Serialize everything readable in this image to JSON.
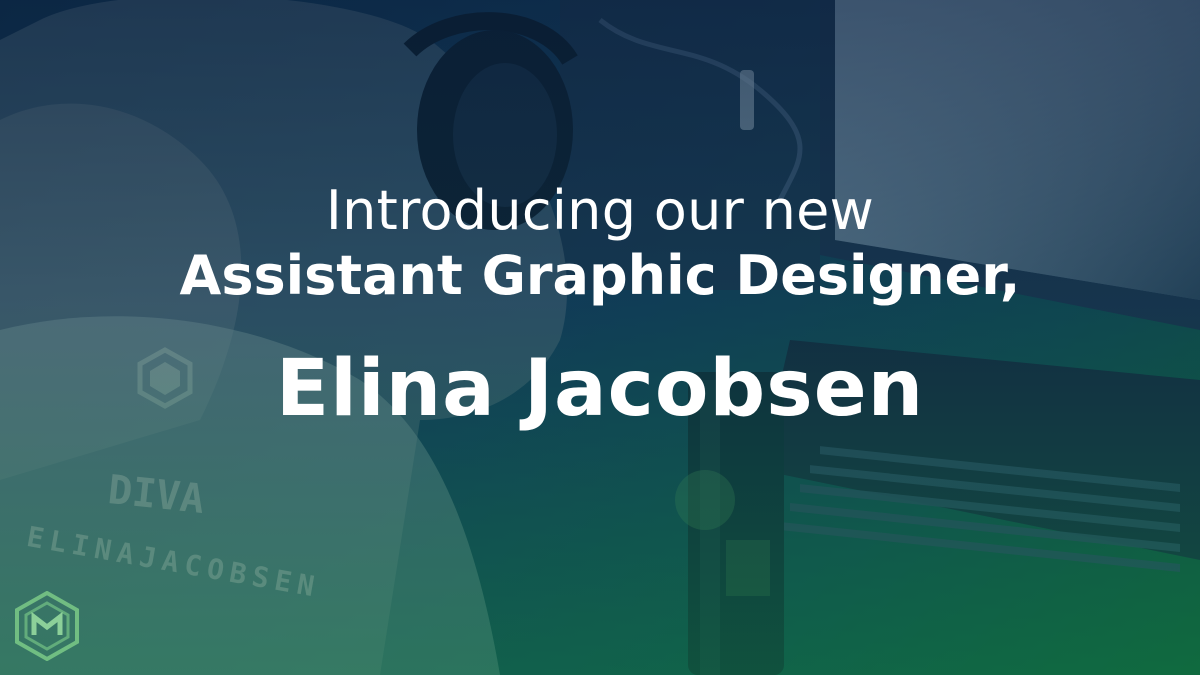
{
  "headline": {
    "intro": "Introducing our new",
    "role": "Assistant Graphic Designer,",
    "name": "Elina Jacobsen"
  },
  "shirt": {
    "top": "DIVA",
    "bottom": "ELINAJACOBSEN"
  },
  "colors": {
    "top": "#0e2a46",
    "bottom": "#0e5a36",
    "text": "#ffffff"
  },
  "icons": [
    "headphones-icon",
    "brand-logo-icon",
    "energy-can-icon"
  ]
}
